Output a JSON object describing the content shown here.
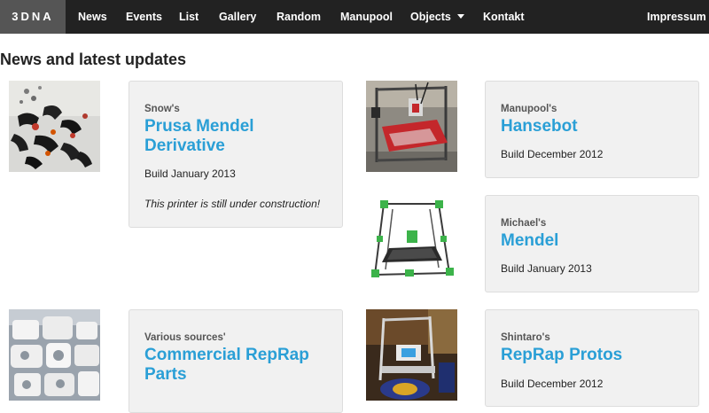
{
  "navbar": {
    "brand": "3DNA",
    "items": [
      {
        "label": "News"
      },
      {
        "label": "Events"
      },
      {
        "label": "List"
      },
      {
        "label": "Gallery"
      },
      {
        "label": "Random"
      },
      {
        "label": "Manupool"
      },
      {
        "label": "Objects",
        "has_dropdown": true
      },
      {
        "label": "Kontakt"
      }
    ],
    "right_item": "Impressum"
  },
  "page_title": "News and latest updates",
  "entries": [
    {
      "owner": "Snow's",
      "title": "Prusa Mendel Derivative",
      "build": "Build January 2013",
      "note": "This printer is still under construction!"
    },
    {
      "owner": "Manupool's",
      "title": "Hansebot",
      "build": "Build December 2012"
    },
    {
      "owner": "Michael's",
      "title": "Mendel",
      "build": "Build January 2013"
    },
    {
      "owner": "Various sources'",
      "title": "Commercial RepRap Parts",
      "build": ""
    },
    {
      "owner": "Shintaro's",
      "title": "RepRap Protos",
      "build": "Build December 2012"
    }
  ],
  "colors": {
    "navbar_bg": "#222222",
    "brand_bg": "#555555",
    "link": "#2a9fd6",
    "card_bg": "#f1f1f1"
  }
}
